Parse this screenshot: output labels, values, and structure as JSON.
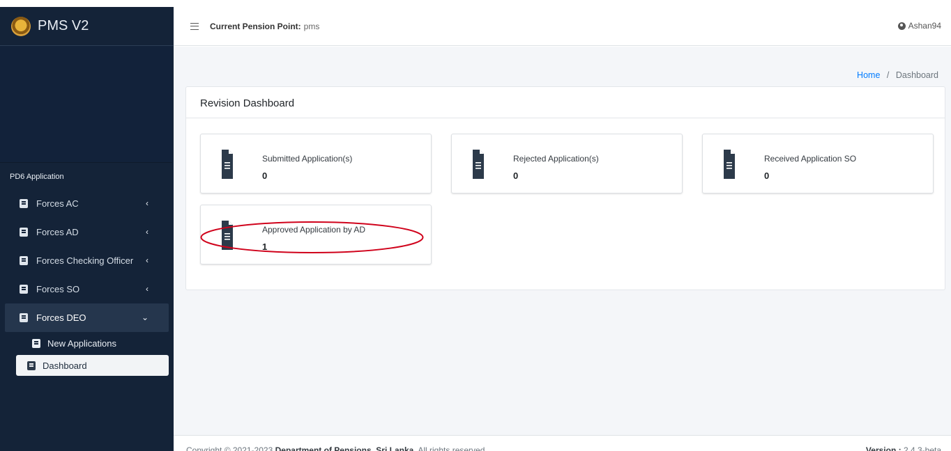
{
  "brand": {
    "title": "PMS V2"
  },
  "sidebar": {
    "section_header": "PD6 Application",
    "items": [
      {
        "label": "Forces AC"
      },
      {
        "label": "Forces AD"
      },
      {
        "label": "Forces Checking Officer"
      },
      {
        "label": "Forces SO"
      },
      {
        "label": "Forces DEO"
      }
    ],
    "sub_items": [
      {
        "label": "New Applications"
      },
      {
        "label": "Dashboard"
      }
    ]
  },
  "header": {
    "pension_point_label": "Current Pension Point:",
    "pension_point_value": "pms",
    "user": "Ashan94"
  },
  "breadcrumb": {
    "home": "Home",
    "sep": "/",
    "current": "Dashboard"
  },
  "dashboard": {
    "title": "Revision Dashboard",
    "boxes": [
      {
        "label": "Submitted Application(s)",
        "count": "0"
      },
      {
        "label": "Rejected Application(s)",
        "count": "0"
      },
      {
        "label": "Received Application SO",
        "count": "0"
      },
      {
        "label": "Approved Application by AD",
        "count": "1"
      }
    ]
  },
  "footer": {
    "copyright_prefix": "Copyright © 2021-2023",
    "org": "Department of Pensions, Sri Lanka.",
    "rights": "All rights reserved.",
    "version_label": "Version :",
    "version_value": "2.4.3-beta"
  },
  "colors": {
    "sidebar_bg": "#142338",
    "link": "#007bff",
    "highlight_ring": "#d0021b"
  }
}
